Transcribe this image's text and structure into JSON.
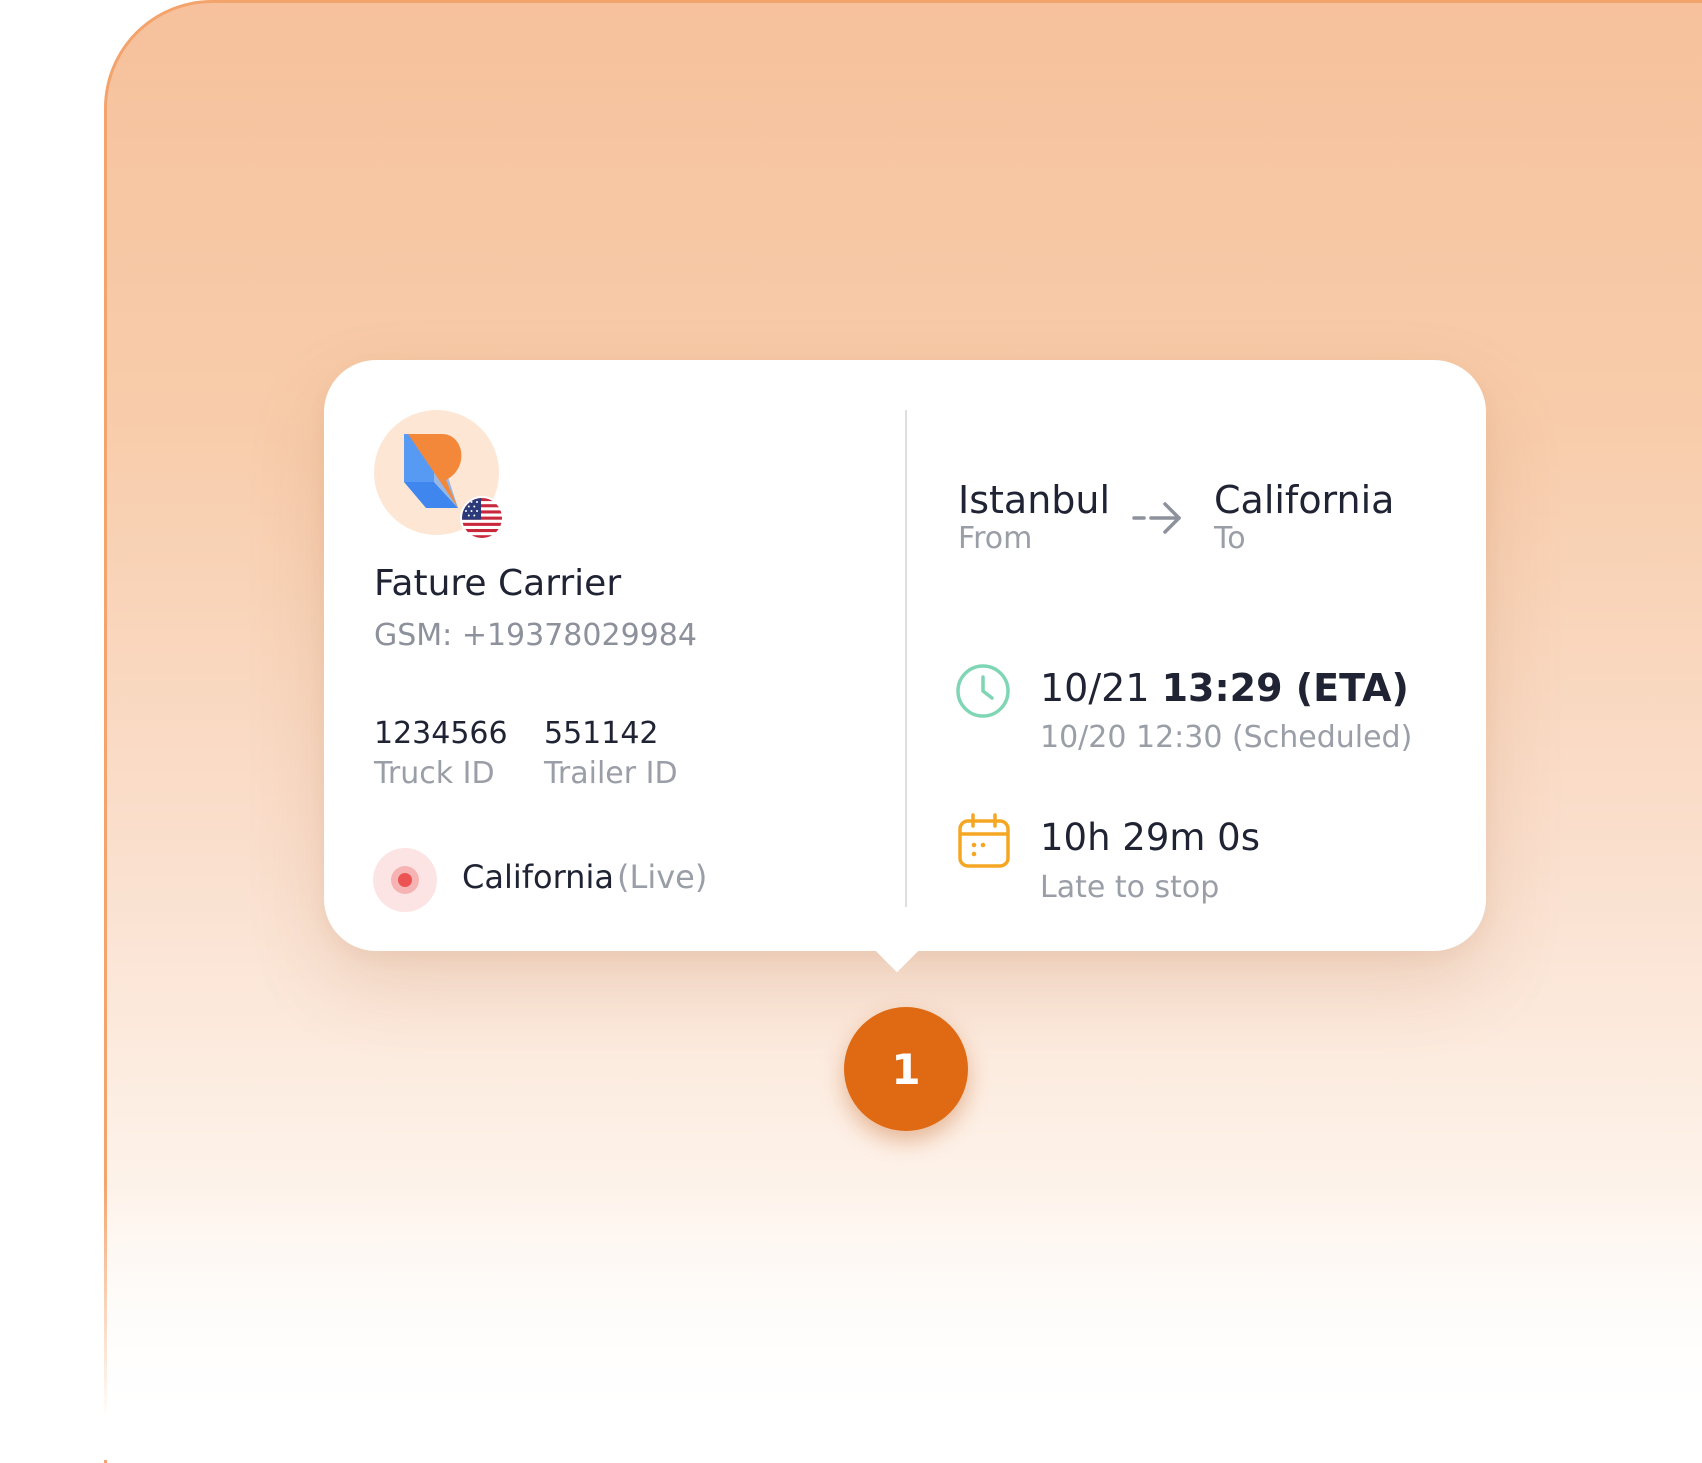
{
  "carrier": {
    "name": "Fature Carrier",
    "gsm": "GSM: +19378029984",
    "logo_icon": "carrier-logo",
    "country_flag": "us-flag-icon",
    "truck_id": "1234566",
    "truck_id_label": "Truck ID",
    "trailer_id": "551142",
    "trailer_id_label": "Trailer ID",
    "location": "California",
    "location_status": "(Live)"
  },
  "route": {
    "from_city": "Istanbul",
    "from_label": "From",
    "to_city": "California",
    "to_label": "To"
  },
  "schedule": {
    "eta_date": "10/21",
    "eta_time": "13:29 (ETA)",
    "scheduled": "10/20 12:30 (Scheduled)",
    "duration": "10h 29m 0s",
    "status": "Late to stop"
  },
  "marker": {
    "label": "1"
  },
  "colors": {
    "accent": "#e06a14",
    "clock": "#7fd6b4",
    "calendar": "#f5a623",
    "live": "#ec5454"
  }
}
